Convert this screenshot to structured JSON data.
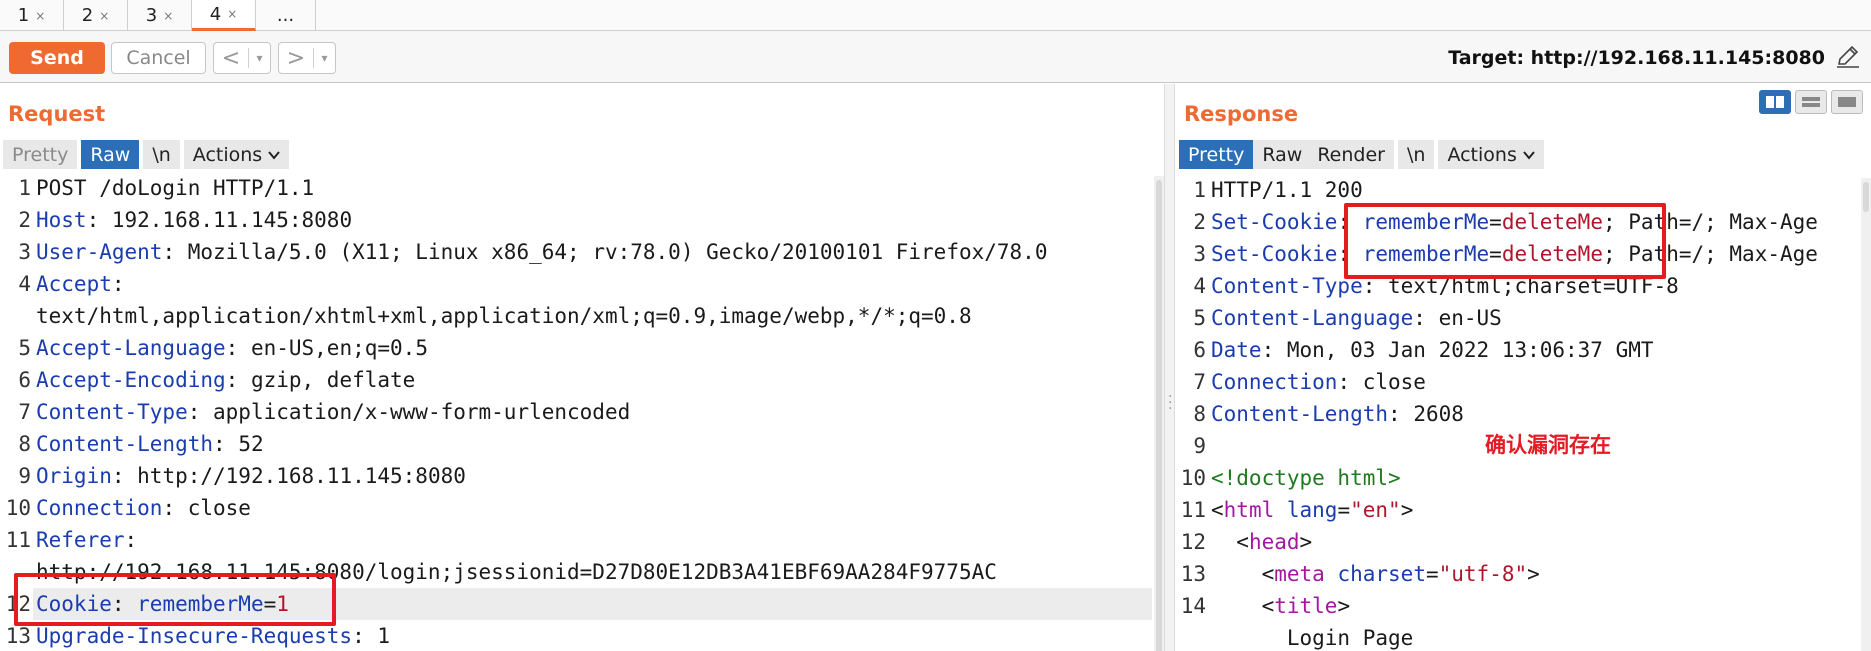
{
  "tabs": [
    {
      "label": "1",
      "close": "×",
      "active": false
    },
    {
      "label": "2",
      "close": "×",
      "active": false
    },
    {
      "label": "3",
      "close": "×",
      "active": false
    },
    {
      "label": "4",
      "close": "×",
      "active": true
    }
  ],
  "tabs_more": "...",
  "toolbar": {
    "send_label": "Send",
    "cancel_label": "Cancel",
    "back_label": "<",
    "forward_label": ">",
    "dropdown_glyph": "▾",
    "target_label": "Target: http://192.168.11.145:8080"
  },
  "request": {
    "title": "Request",
    "subtabs": {
      "pretty": "Pretty",
      "raw": "Raw",
      "newline": "\\n",
      "actions": "Actions"
    },
    "lines": [
      {
        "n": "1",
        "key": "",
        "sep": "",
        "val": "POST /doLogin HTTP/1.1"
      },
      {
        "n": "2",
        "key": "Host",
        "sep": ": ",
        "val": "192.168.11.145:8080"
      },
      {
        "n": "3",
        "key": "User-Agent",
        "sep": ": ",
        "val": "Mozilla/5.0 (X11; Linux x86_64; rv:78.0) Gecko/20100101 Firefox/78.0"
      },
      {
        "n": "4",
        "key": "Accept",
        "sep": ":",
        "val": ""
      },
      {
        "n": "",
        "key": "",
        "sep": "",
        "val": "text/html,application/xhtml+xml,application/xml;q=0.9,image/webp,*/*;q=0.8"
      },
      {
        "n": "5",
        "key": "Accept-Language",
        "sep": ": ",
        "val": "en-US,en;q=0.5"
      },
      {
        "n": "6",
        "key": "Accept-Encoding",
        "sep": ": ",
        "val": "gzip, deflate"
      },
      {
        "n": "7",
        "key": "Content-Type",
        "sep": ": ",
        "val": "application/x-www-form-urlencoded"
      },
      {
        "n": "8",
        "key": "Content-Length",
        "sep": ": ",
        "val": "52"
      },
      {
        "n": "9",
        "key": "Origin",
        "sep": ": ",
        "val": "http://192.168.11.145:8080"
      },
      {
        "n": "10",
        "key": "Connection",
        "sep": ": ",
        "val": "close"
      },
      {
        "n": "11",
        "key": "Referer",
        "sep": ":",
        "val": ""
      },
      {
        "n": "",
        "key": "",
        "sep": "",
        "val": "http://192.168.11.145:8080/login;jsessionid=D27D80E12DB3A41EBF69AA284F9775AC"
      },
      {
        "n": "12",
        "key": "Cookie",
        "sep": ": ",
        "val": "",
        "cookie_name": "rememberMe",
        "cookie_eq": "=",
        "cookie_val": "1"
      },
      {
        "n": "13",
        "key": "Upgrade-Insecure-Requests",
        "sep": ": ",
        "val": "1"
      }
    ]
  },
  "response": {
    "title": "Response",
    "subtabs": {
      "pretty": "Pretty",
      "raw": "Raw",
      "render": "Render",
      "newline": "\\n",
      "actions": "Actions"
    },
    "lines": [
      {
        "n": "1",
        "plain": "HTTP/1.1 200"
      },
      {
        "n": "2",
        "key": "Set-Cookie",
        "sep": ": ",
        "cookie_name": "rememberMe",
        "cookie_eq": "=",
        "cookie_val": "deleteMe",
        "rest": "; Path=/; Max-Age"
      },
      {
        "n": "3",
        "key": "Set-Cookie",
        "sep": ": ",
        "cookie_name": "rememberMe",
        "cookie_eq": "=",
        "cookie_val": "deleteMe",
        "rest": "; Path=/; Max-Age"
      },
      {
        "n": "4",
        "key": "Content-Type",
        "sep": ": ",
        "val": "text/html;charset=UTF-8"
      },
      {
        "n": "5",
        "key": "Content-Language",
        "sep": ": ",
        "val": "en-US"
      },
      {
        "n": "6",
        "key": "Date",
        "sep": ": ",
        "val": "Mon, 03 Jan 2022 13:06:37 GMT"
      },
      {
        "n": "7",
        "key": "Connection",
        "sep": ": ",
        "val": "close"
      },
      {
        "n": "8",
        "key": "Content-Length",
        "sep": ": ",
        "val": "2608"
      },
      {
        "n": "9",
        "plain": ""
      },
      {
        "n": "10",
        "doctype": "<!doctype html>"
      },
      {
        "n": "11",
        "tag_open": "<",
        "tag": "html",
        "attr": " lang",
        "eq": "=",
        "str": "\"en\"",
        "tag_close": ">",
        "indent": ""
      },
      {
        "n": "12",
        "tag_open": "<",
        "tag": "head",
        "tag_close": ">",
        "indent": "  "
      },
      {
        "n": "13",
        "tag_open": "<",
        "tag": "meta",
        "attr": " charset",
        "eq": "=",
        "str": "\"utf-8\"",
        "tag_close": ">",
        "indent": "    "
      },
      {
        "n": "14",
        "tag_open": "<",
        "tag": "title",
        "tag_close": ">",
        "indent": "    "
      },
      {
        "n": "",
        "plain": "      Login Page"
      }
    ],
    "annotation": "确认漏洞存在"
  }
}
